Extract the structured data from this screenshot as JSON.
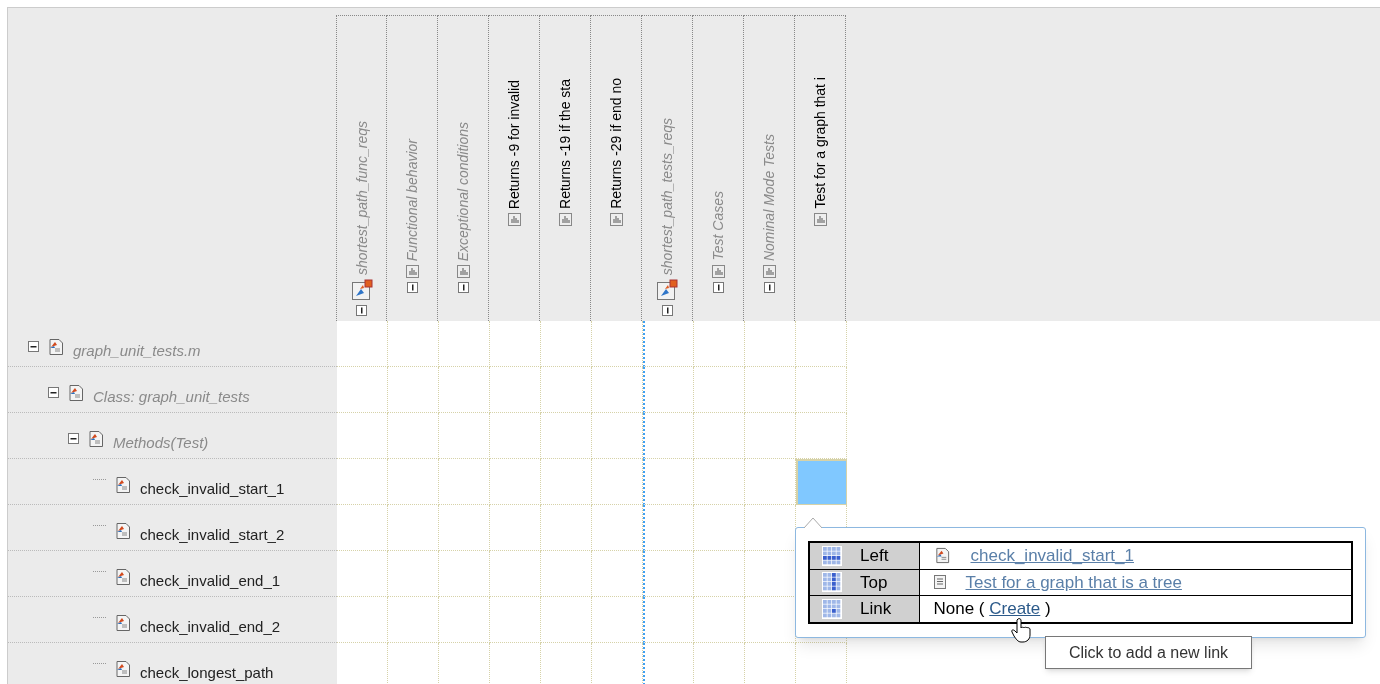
{
  "columns": [
    {
      "kind": "set",
      "label": "shortest_path_func_reqs",
      "expanded": true
    },
    {
      "kind": "group",
      "label": "Functional behavior",
      "expanded": true
    },
    {
      "kind": "group",
      "label": "Exceptional conditions",
      "expanded": true
    },
    {
      "kind": "req",
      "label": "Returns -9 for invalid"
    },
    {
      "kind": "req",
      "label": "Returns -19 if the sta"
    },
    {
      "kind": "req",
      "label": "Returns -29 if end no"
    },
    {
      "kind": "set",
      "label": "shortest_path_tests_reqs",
      "expanded": true
    },
    {
      "kind": "group",
      "label": "Test Cases",
      "expanded": true
    },
    {
      "kind": "group",
      "label": "Nominal Mode Tests",
      "expanded": true
    },
    {
      "kind": "req",
      "label": "Test for a graph that i"
    }
  ],
  "tree": [
    {
      "label": "graph_unit_tests.m",
      "expanded": true,
      "cells": [
        {
          "selected": false
        },
        {
          "selected": false
        },
        {
          "selected": false
        },
        {
          "selected": false
        },
        {
          "selected": false
        },
        {
          "selected": false
        },
        {
          "selected": false
        },
        {
          "selected": false
        },
        {
          "selected": false
        },
        {
          "selected": false
        }
      ],
      "children": [
        {
          "label": "Class: graph_unit_tests",
          "expanded": true,
          "cells": [
            {
              "selected": false
            },
            {
              "selected": false
            },
            {
              "selected": false
            },
            {
              "selected": false
            },
            {
              "selected": false
            },
            {
              "selected": false
            },
            {
              "selected": false
            },
            {
              "selected": false
            },
            {
              "selected": false
            },
            {
              "selected": false
            }
          ],
          "children": [
            {
              "label": "Methods(Test)",
              "expanded": true,
              "cells": [
                {
                  "selected": false
                },
                {
                  "selected": false
                },
                {
                  "selected": false
                },
                {
                  "selected": false
                },
                {
                  "selected": false
                },
                {
                  "selected": false
                },
                {
                  "selected": false
                },
                {
                  "selected": false
                },
                {
                  "selected": false
                },
                {
                  "selected": false
                }
              ],
              "children": [
                {
                  "label": "check_invalid_start_1",
                  "cells": [
                    {
                      "selected": false
                    },
                    {
                      "selected": false
                    },
                    {
                      "selected": false
                    },
                    {
                      "selected": false
                    },
                    {
                      "selected": false
                    },
                    {
                      "selected": false
                    },
                    {
                      "selected": false
                    },
                    {
                      "selected": false
                    },
                    {
                      "selected": false
                    },
                    {
                      "selected": true
                    }
                  ]
                },
                {
                  "label": "check_invalid_start_2",
                  "cells": [
                    {
                      "selected": false
                    },
                    {
                      "selected": false
                    },
                    {
                      "selected": false
                    },
                    {
                      "selected": false
                    },
                    {
                      "selected": false
                    },
                    {
                      "selected": false
                    },
                    {
                      "selected": false
                    },
                    {
                      "selected": false
                    },
                    {
                      "selected": false
                    },
                    {
                      "selected": false
                    }
                  ]
                },
                {
                  "label": "check_invalid_end_1",
                  "cells": [
                    {
                      "selected": false
                    },
                    {
                      "selected": false
                    },
                    {
                      "selected": false
                    },
                    {
                      "selected": false
                    },
                    {
                      "selected": false
                    },
                    {
                      "selected": false
                    },
                    {
                      "selected": false
                    },
                    {
                      "selected": false
                    },
                    {
                      "selected": false
                    }
                  ]
                },
                {
                  "label": "check_invalid_end_2",
                  "cells": [
                    {
                      "selected": false
                    },
                    {
                      "selected": false
                    },
                    {
                      "selected": false
                    },
                    {
                      "selected": false
                    },
                    {
                      "selected": false
                    },
                    {
                      "selected": false
                    },
                    {
                      "selected": false
                    },
                    {
                      "selected": false
                    },
                    {
                      "selected": false
                    },
                    {
                      "selected": false
                    }
                  ]
                },
                {
                  "label": "check_longest_path",
                  "cells": [
                    {
                      "selected": false
                    },
                    {
                      "selected": false
                    },
                    {
                      "selected": false
                    },
                    {
                      "selected": false
                    },
                    {
                      "selected": false
                    },
                    {
                      "selected": false
                    },
                    {
                      "selected": false
                    },
                    {
                      "selected": false
                    },
                    {
                      "selected": false
                    },
                    {
                      "selected": false
                    }
                  ]
                }
              ]
            }
          ]
        }
      ]
    }
  ],
  "popup": {
    "rows": [
      {
        "kind": "row",
        "label": "Left",
        "value": "check_invalid_start_1"
      },
      {
        "kind": "column",
        "label": "Top",
        "value": "Test for a graph that is a tree"
      },
      {
        "kind": "cell",
        "label": "Link",
        "text_before": "None (",
        "link": "Create",
        "text_after": ")"
      }
    ],
    "tooltip": "Click to add a new link"
  }
}
